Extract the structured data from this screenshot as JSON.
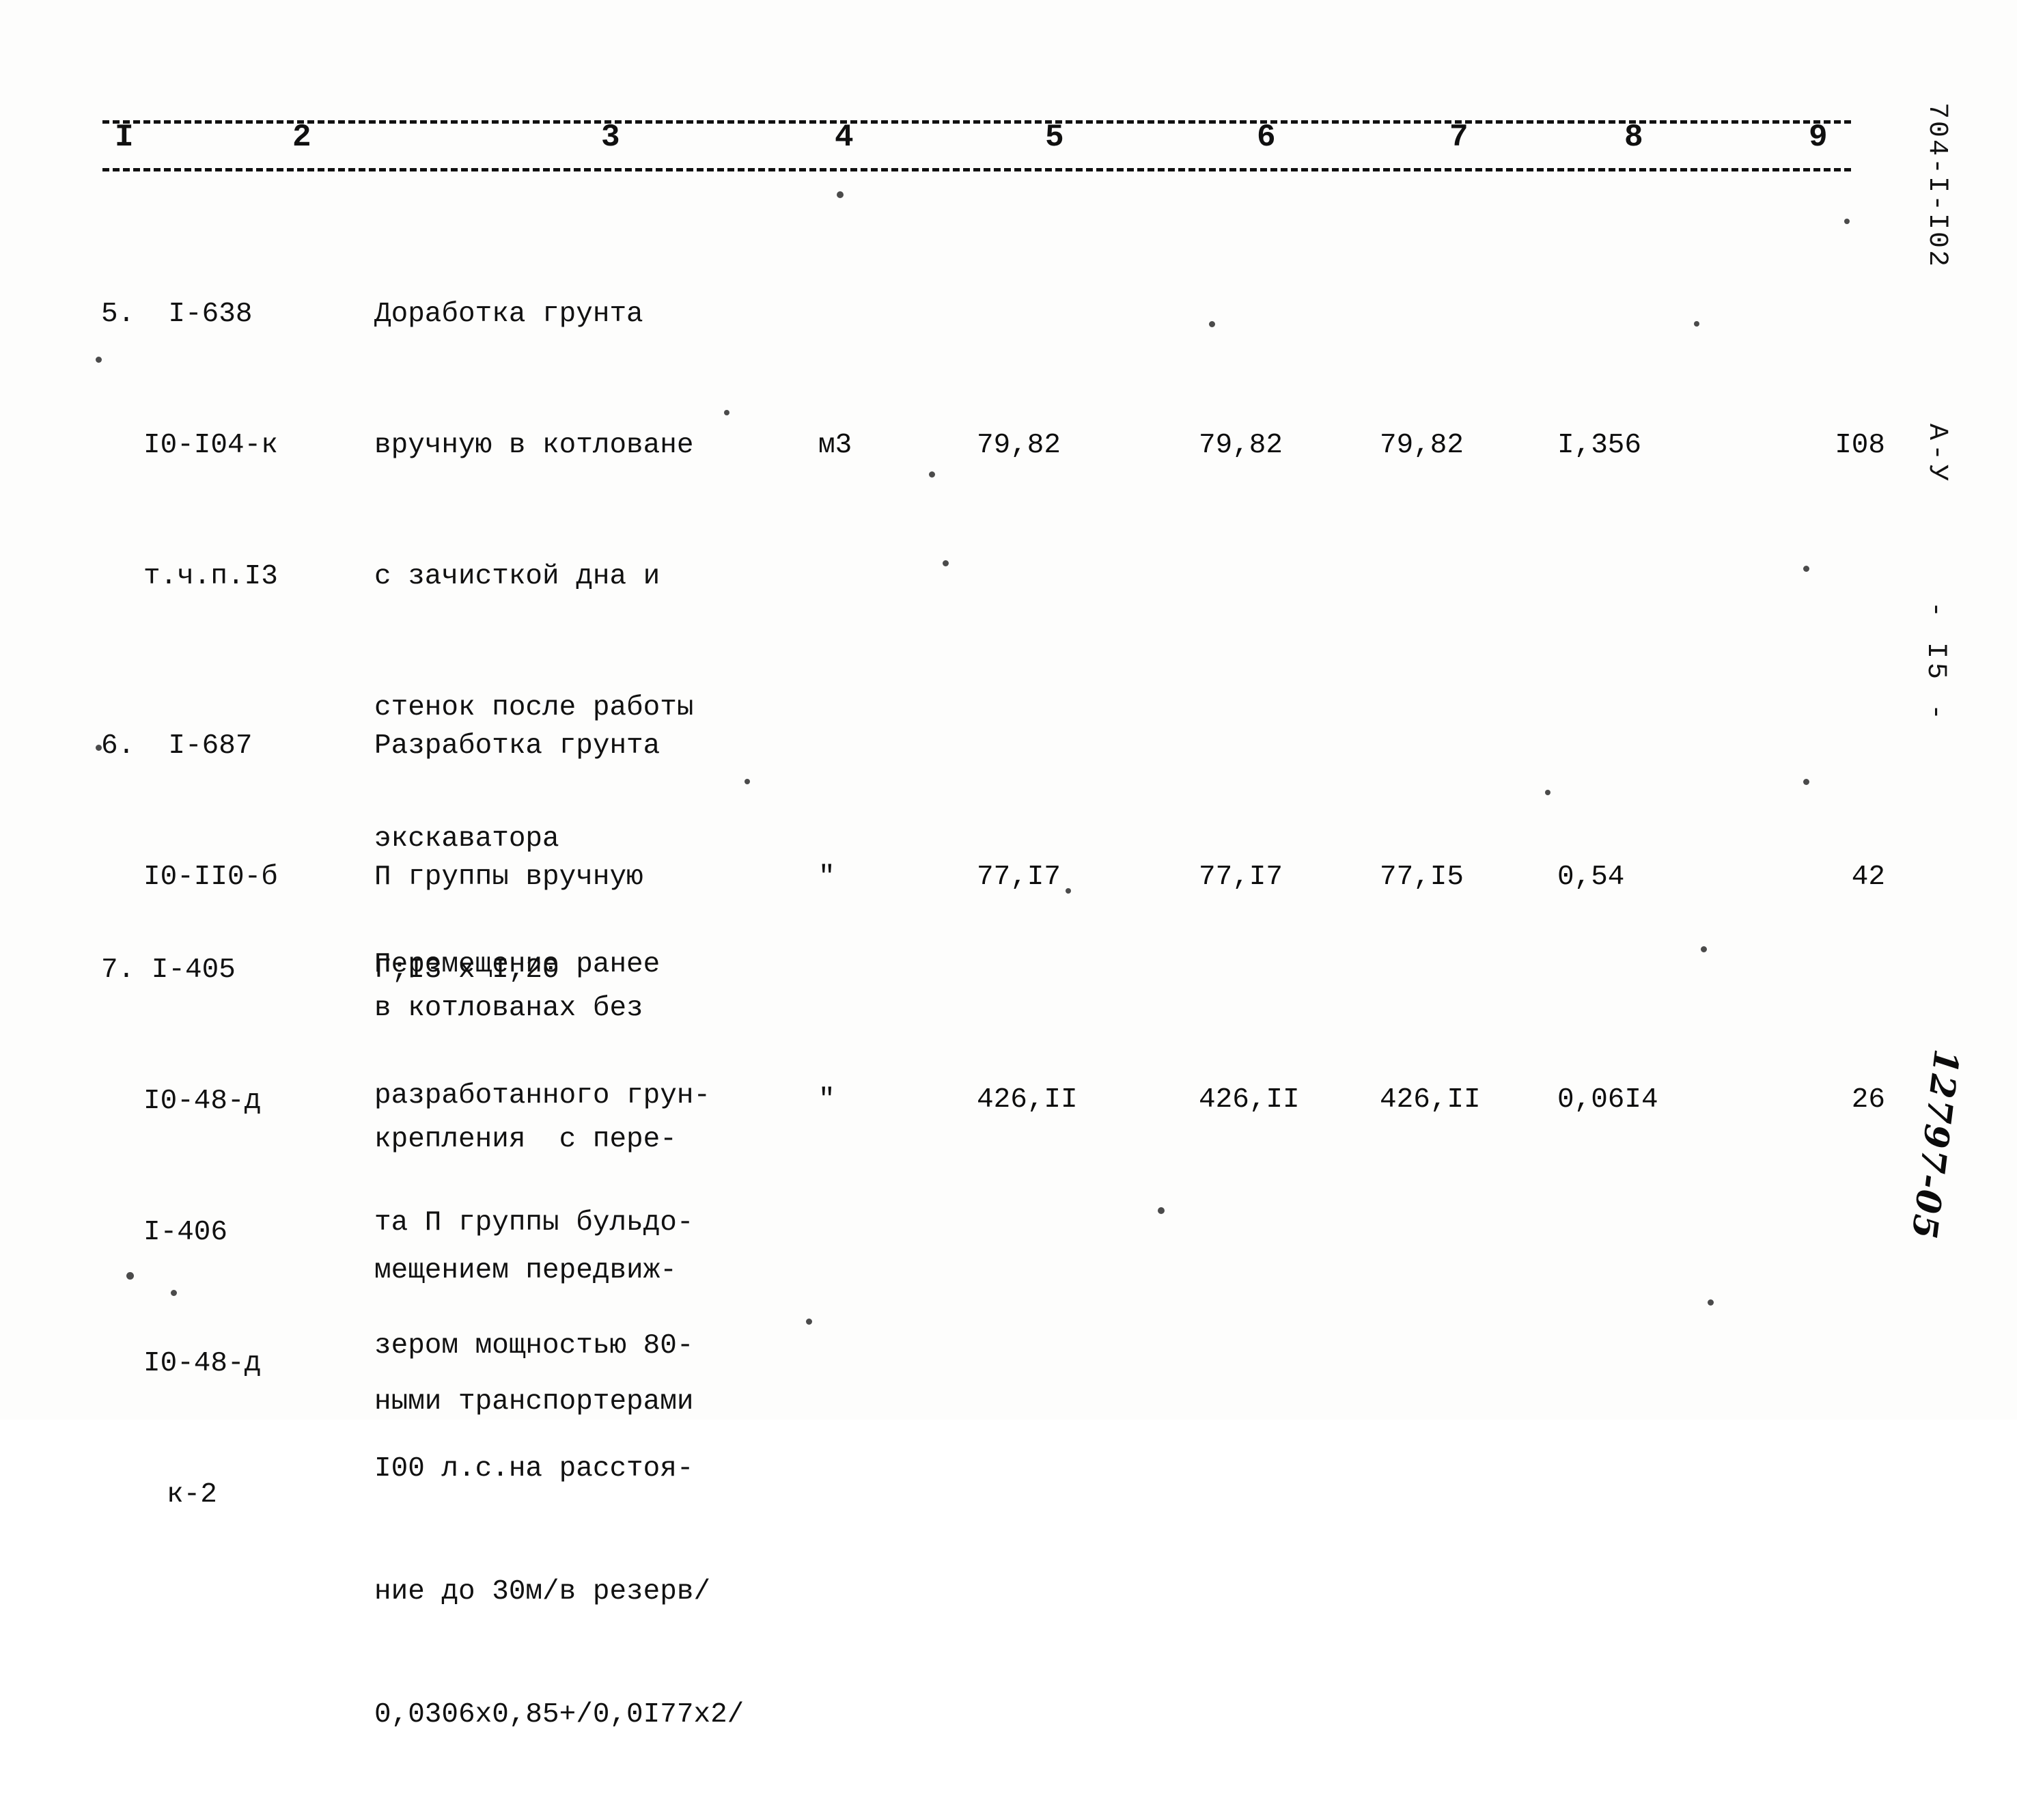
{
  "document": {
    "column_headers": [
      "I",
      "2",
      "3",
      "4",
      "5",
      "6",
      "7",
      "8",
      "9"
    ],
    "margin": {
      "doc_code": "704-I-I02",
      "series": "А-У",
      "page_label": "- I5 -",
      "handwritten_number": "12797-05"
    }
  },
  "rows": [
    {
      "number": "5.",
      "codes": [
        "5.  I-638",
        "I0-I04-к",
        "т.ч.п.I3"
      ],
      "description": [
        "Доработка грунта",
        "вручную в котловане",
        "с зачисткой дна и",
        "стенок после работы",
        "экскаватора",
        "Г;I3 х I,20"
      ],
      "unit": "м3",
      "col5": "79,82",
      "col6": "79,82",
      "col7": "79,82",
      "col8": "I,356",
      "col9": "I08"
    },
    {
      "number": "6.",
      "codes": [
        "6.  I-687",
        "I0-II0-б"
      ],
      "description": [
        "Разработка грунта",
        "П группы вручную",
        "в котлованах без",
        "крепления  с пере-",
        "мещением передвиж-",
        "ными транспортерами"
      ],
      "unit": "\"",
      "col5": "77,I7",
      "col6": "77,I7",
      "col7": "77,I5",
      "col8": "0,54",
      "col9": "42"
    },
    {
      "number": "7.",
      "codes": [
        "7. I-405",
        "I0-48-д",
        "I-406",
        "I0-48-д",
        "к-2"
      ],
      "description": [
        "Перемещение ранее",
        "разработанного грун-",
        "та П группы бульдо-",
        "зером мощностью 80-",
        "I00 л.с.на расстоя-",
        "ние до 30м/в резерв/",
        "0,0306х0,85+/0,0I77х2/"
      ],
      "unit": "\"",
      "col5": "426,II",
      "col6": "426,II",
      "col7": "426,II",
      "col8": "0,06I4",
      "col9": "26"
    }
  ]
}
